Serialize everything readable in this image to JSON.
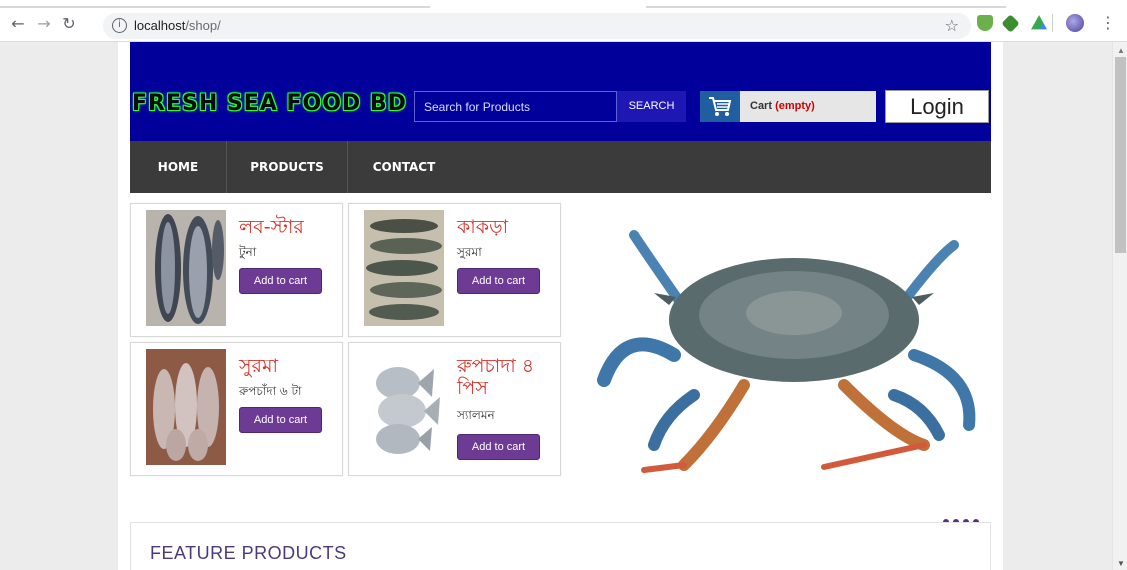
{
  "browser": {
    "url_host": "localhost",
    "url_path": "/shop/"
  },
  "header": {
    "logo_text": "FRESH SEA FOOD BD",
    "search_placeholder": "Search for Products",
    "search_button": "SEARCH",
    "cart_label": "Cart",
    "cart_status": "(empty)",
    "login_label": "Login"
  },
  "nav": {
    "items": [
      {
        "label": "HOME"
      },
      {
        "label": "PRODUCTS"
      },
      {
        "label": "CONTACT"
      }
    ]
  },
  "products": [
    {
      "name": "লব-স্টার",
      "subtitle": "টুনা",
      "button": "Add to cart"
    },
    {
      "name": "কাকড়া",
      "subtitle": "সুরমা",
      "button": "Add to cart"
    },
    {
      "name": "সুরমা",
      "subtitle": "রুপচাঁদা ৬ টা",
      "button": "Add to cart"
    },
    {
      "name": "রুপচাদা ৪ পিস",
      "subtitle": "স্যালমন",
      "button": "Add to cart"
    }
  ],
  "feature": {
    "title": "FEATURE PRODUCTS"
  },
  "colors": {
    "header_bg": "#02009a",
    "nav_bg": "#3b3b3b",
    "accent_purple": "#6d3a94",
    "product_name": "#d4332a"
  }
}
